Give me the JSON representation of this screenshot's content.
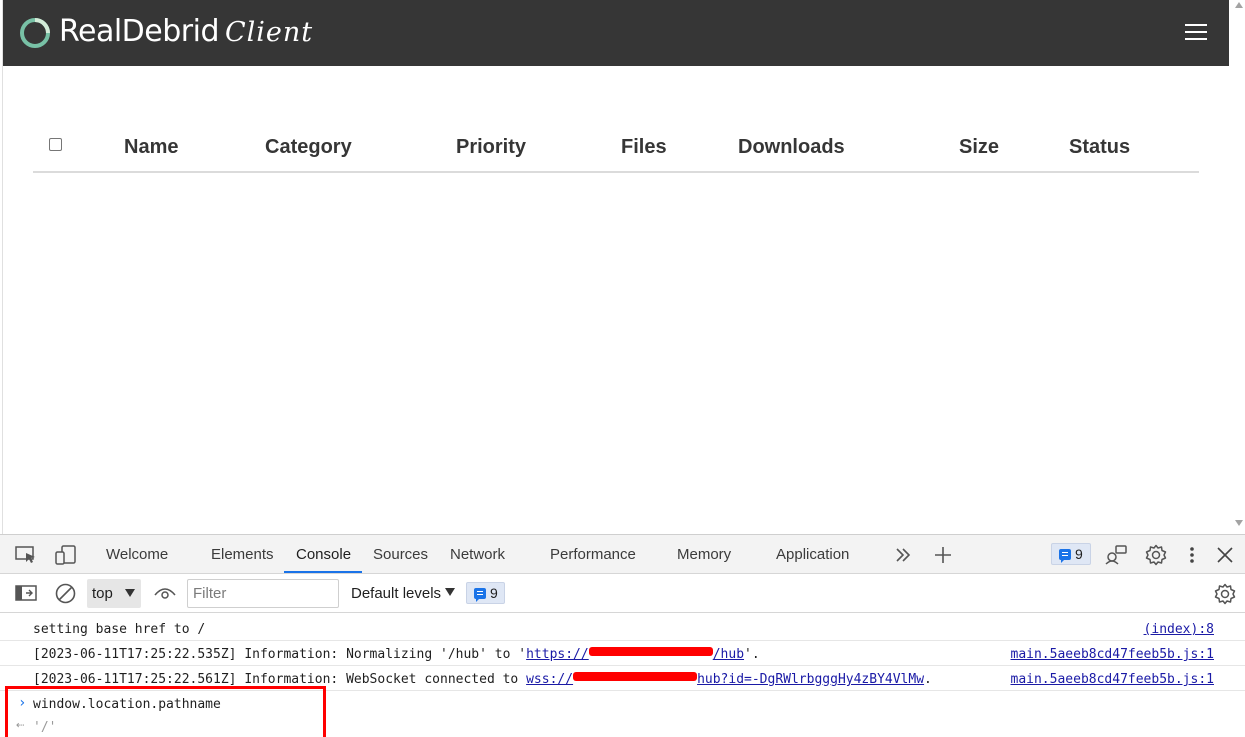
{
  "app": {
    "logo_text": "RealDebrid",
    "logo_sub": "Client",
    "menu_icon": "hamburger-icon",
    "table_headers": [
      "Name",
      "Category",
      "Priority",
      "Files",
      "Downloads",
      "Size",
      "Status"
    ],
    "colors": {
      "navbar": "#363636",
      "logo_accent": "#78c1a6"
    }
  },
  "devtools": {
    "tabs": [
      "Welcome",
      "Elements",
      "Console",
      "Sources",
      "Network",
      "Performance",
      "Memory",
      "Application"
    ],
    "active_tab": "Console",
    "message_count": "9",
    "toolbar": {
      "context": "top",
      "filter_placeholder": "Filter",
      "levels_label": "Default levels",
      "message_count": "9"
    },
    "console": [
      {
        "text": "setting base href to /",
        "source": "(index):8"
      },
      {
        "prefix": "[2023-06-11T17:25:22.535Z] Information: Normalizing '/hub' to '",
        "link_start": "https://",
        "link_end": "/hub",
        "suffix": "'.",
        "source": "main.5aeeb8cd47feeb5b.js:1"
      },
      {
        "prefix": "[2023-06-11T17:25:22.561Z] Information: WebSocket connected to ",
        "link_start": "wss://",
        "link_end": "hub?id=-DgRWlrbgggHy4zBY4VlMw",
        "suffix": ".",
        "source": "main.5aeeb8cd47feeb5b.js:1"
      }
    ],
    "input": "window.location.pathname",
    "result": "'/'"
  }
}
